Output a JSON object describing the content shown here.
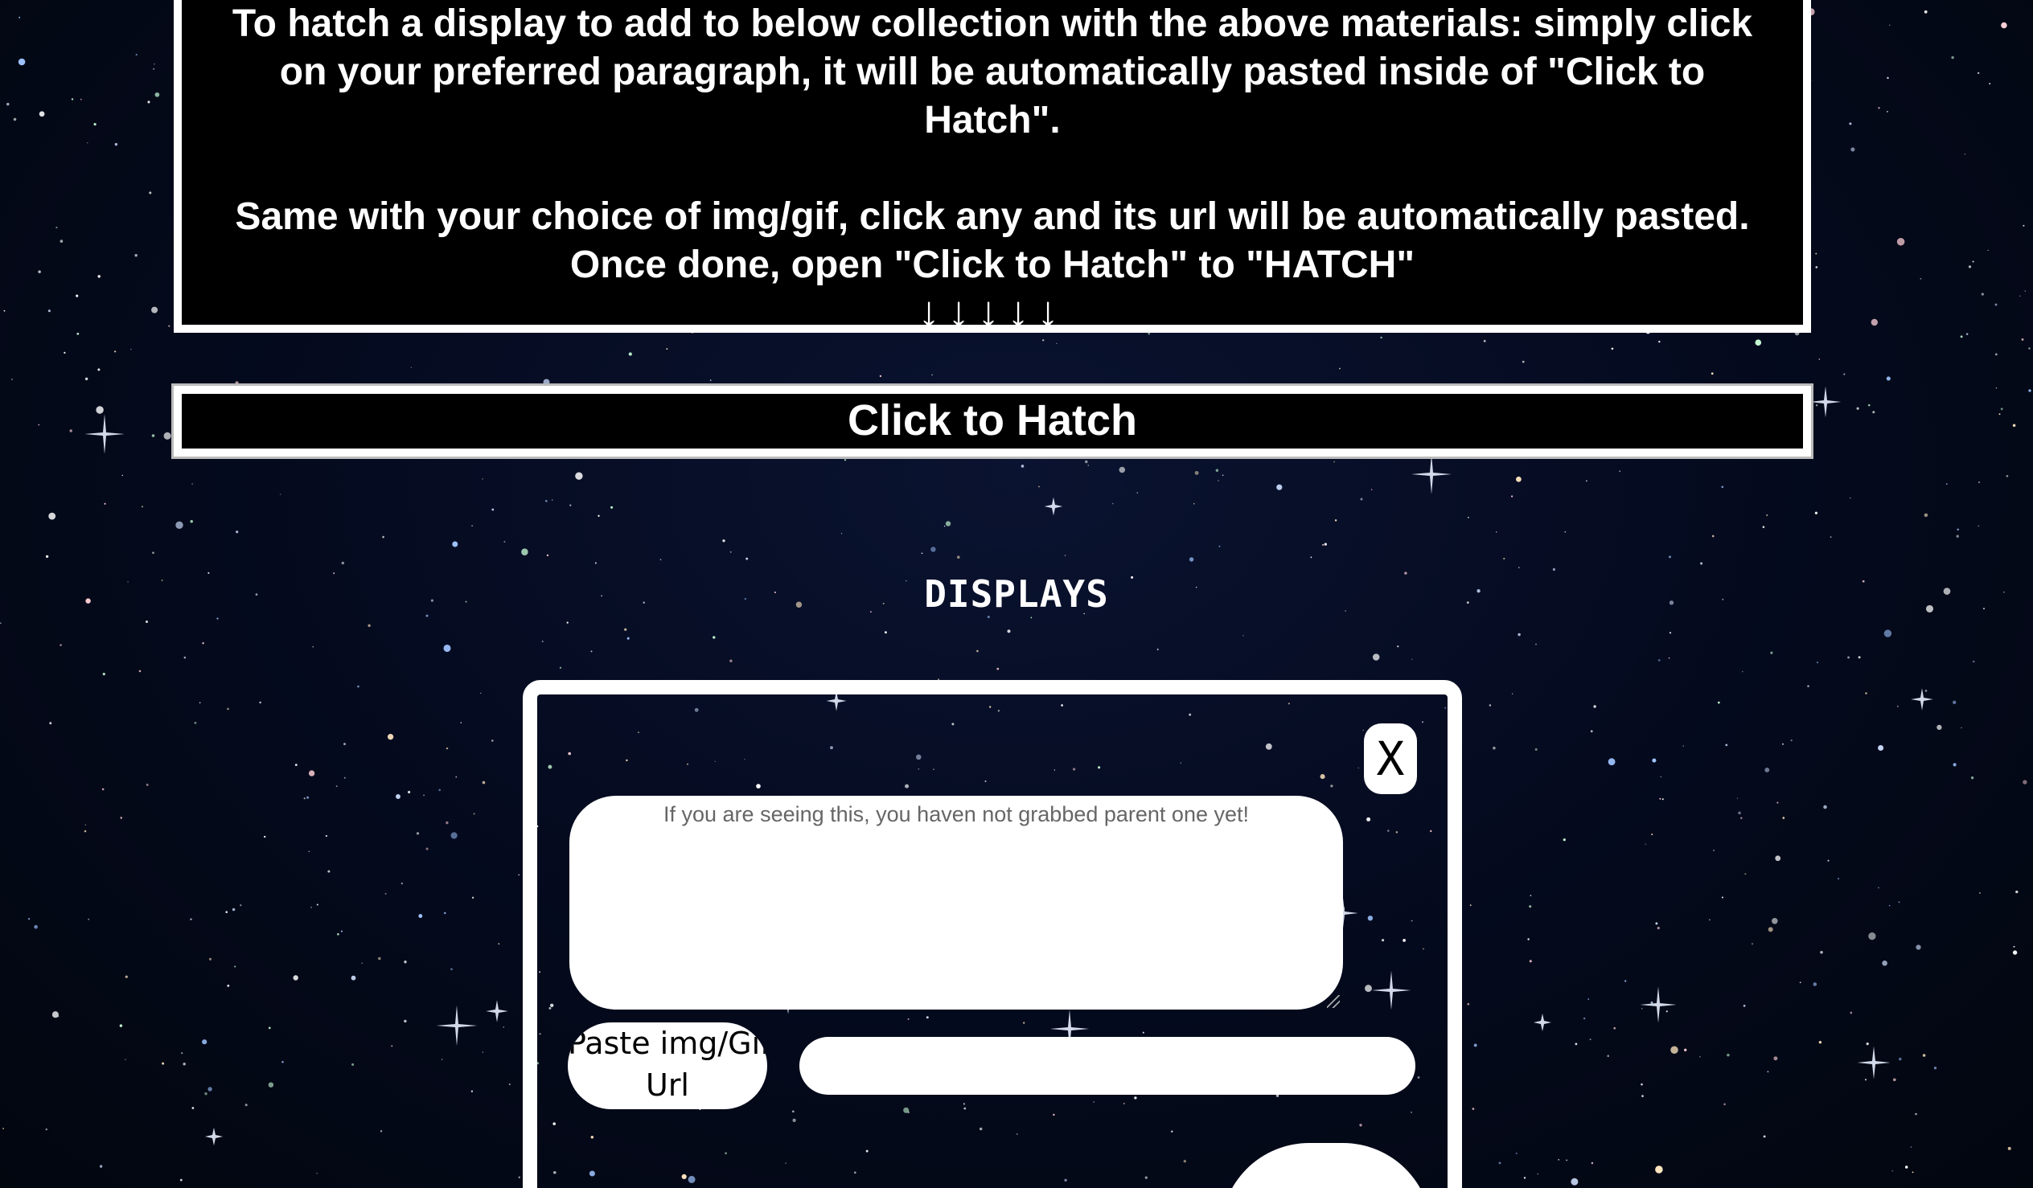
{
  "instructions": {
    "line1": "To hatch a display to add to below collection with the above materials: simply click",
    "line2": "on your preferred paragraph, it will be automatically pasted inside of \"Click to",
    "line3": "Hatch\".",
    "line4": "Same with your choice of img/gif, click any and its url will be automatically pasted.",
    "line5": "Once done, open \"Click to Hatch\" to \"HATCH\"",
    "arrows": "↓↓↓↓↓"
  },
  "hatch_bar": {
    "label": "Click to Hatch"
  },
  "displays": {
    "title": "DISPLAYS"
  },
  "card": {
    "close_label": "X",
    "parent_text": "If you are seeing this, you haven not grabbed parent one yet!",
    "paste_label_line1": "Paste img/Gif",
    "paste_label_line2": "Url",
    "url_value": ""
  },
  "colors": {
    "background": "#03081a",
    "panel": "#000000",
    "border": "#ffffff"
  }
}
